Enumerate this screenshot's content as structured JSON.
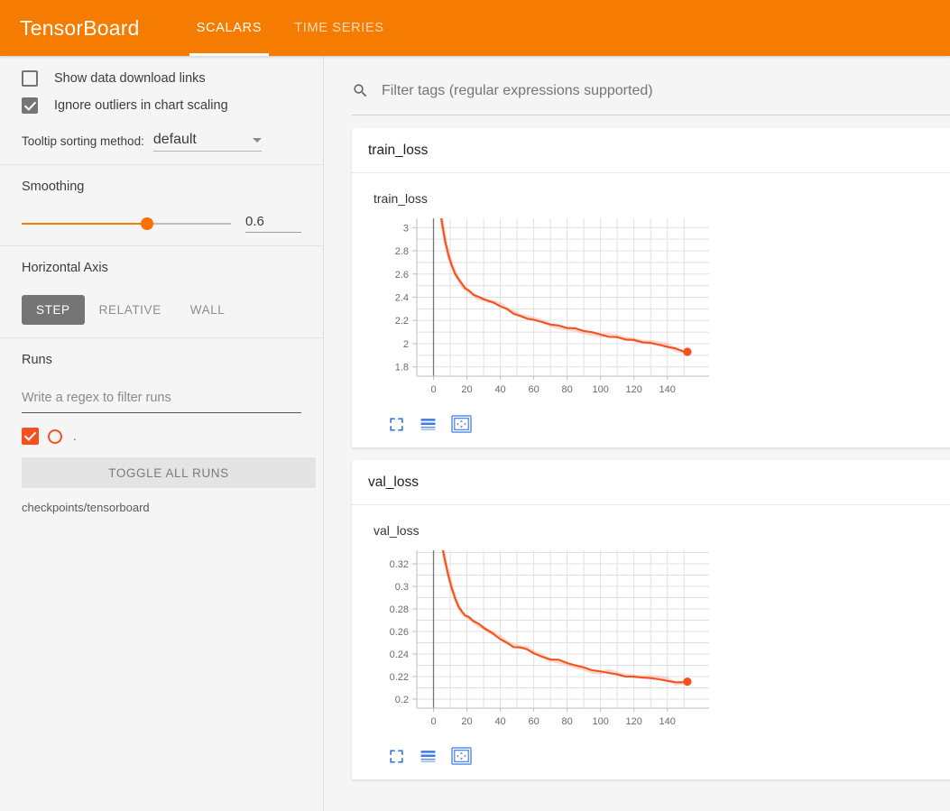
{
  "header": {
    "brand": "TensorBoard",
    "tabs": [
      {
        "label": "SCALARS",
        "active": true
      },
      {
        "label": "TIME SERIES",
        "active": false
      }
    ]
  },
  "sidebar": {
    "checkboxes": [
      {
        "label": "Show data download links",
        "checked": false
      },
      {
        "label": "Ignore outliers in chart scaling",
        "checked": true
      }
    ],
    "tooltip": {
      "label": "Tooltip sorting method:",
      "value": "default"
    },
    "smoothing": {
      "title": "Smoothing",
      "value": "0.6",
      "fraction": 0.6
    },
    "horizontal_axis": {
      "title": "Horizontal Axis",
      "buttons": [
        {
          "label": "STEP",
          "active": true
        },
        {
          "label": "RELATIVE",
          "active": false
        },
        {
          "label": "WALL",
          "active": false
        }
      ]
    },
    "runs": {
      "title": "Runs",
      "filter_placeholder": "Write a regex to filter runs",
      "filter_value": "",
      "run_name": ".",
      "run_color": "#f4511e",
      "toggle_all_label": "TOGGLE ALL RUNS",
      "logdir": "checkpoints/tensorboard"
    }
  },
  "main": {
    "filter_placeholder": "Filter tags (regular expressions supported)",
    "filter_value": "",
    "cards": [
      {
        "header": "train_loss",
        "chart_title": "train_loss"
      },
      {
        "header": "val_loss",
        "chart_title": "val_loss"
      }
    ],
    "toolbar_icons": [
      "expand-icon",
      "data-series-icon",
      "fit-domain-icon"
    ]
  },
  "colors": {
    "brand_orange": "#f57c00",
    "accent_orange": "#ff7003",
    "series_orange": "#f4511e",
    "icon_blue": "#3b78e7"
  },
  "chart_data": [
    {
      "type": "line",
      "title": "train_loss",
      "xlabel": "",
      "ylabel": "",
      "xlim": [
        -10,
        165
      ],
      "ylim": [
        1.72,
        3.08
      ],
      "xticks": [
        0,
        20,
        40,
        60,
        80,
        100,
        120,
        140
      ],
      "yticks": [
        1.8,
        2.0,
        2.2,
        2.4,
        2.6,
        2.8,
        3.0
      ],
      "ytick_labels": [
        "1.8",
        "2",
        "2.2",
        "2.4",
        "2.6",
        "2.8",
        "3"
      ],
      "grid": true,
      "legend": "none",
      "series": [
        {
          "name": "checkpoints/tensorboard",
          "color": "#f4511e",
          "end_marker": true,
          "x": [
            1,
            3,
            5,
            7,
            9,
            11,
            13,
            15,
            17,
            19,
            21,
            24,
            27,
            30,
            33,
            36,
            40,
            44,
            48,
            52,
            56,
            60,
            65,
            70,
            75,
            80,
            85,
            90,
            95,
            100,
            105,
            110,
            115,
            120,
            125,
            130,
            135,
            140,
            145,
            150,
            152
          ],
          "y": [
            3.55,
            3.28,
            3.05,
            2.88,
            2.76,
            2.67,
            2.6,
            2.555,
            2.515,
            2.48,
            2.455,
            2.425,
            2.4,
            2.385,
            2.368,
            2.352,
            2.325,
            2.295,
            2.262,
            2.235,
            2.218,
            2.205,
            2.185,
            2.168,
            2.152,
            2.14,
            2.128,
            2.112,
            2.098,
            2.078,
            2.062,
            2.052,
            2.04,
            2.028,
            2.015,
            2.005,
            1.99,
            1.975,
            1.955,
            1.935,
            1.93
          ]
        }
      ]
    },
    {
      "type": "line",
      "title": "val_loss",
      "xlabel": "",
      "ylabel": "",
      "xlim": [
        -10,
        165
      ],
      "ylim": [
        0.192,
        0.332
      ],
      "xticks": [
        0,
        20,
        40,
        60,
        80,
        100,
        120,
        140
      ],
      "yticks": [
        0.2,
        0.22,
        0.24,
        0.26,
        0.28,
        0.3,
        0.32
      ],
      "ytick_labels": [
        "0.2",
        "0.22",
        "0.24",
        "0.26",
        "0.28",
        "0.3",
        "0.32"
      ],
      "grid": true,
      "legend": "none",
      "series": [
        {
          "name": "checkpoints/tensorboard",
          "color": "#f4511e",
          "end_marker": true,
          "x": [
            1,
            3,
            5,
            7,
            9,
            11,
            13,
            15,
            17,
            19,
            21,
            24,
            27,
            30,
            33,
            36,
            40,
            44,
            48,
            52,
            56,
            60,
            65,
            70,
            75,
            80,
            85,
            90,
            95,
            100,
            105,
            110,
            115,
            120,
            125,
            130,
            135,
            140,
            145,
            150,
            152
          ],
          "y": [
            0.375,
            0.352,
            0.337,
            0.322,
            0.309,
            0.298,
            0.289,
            0.282,
            0.2775,
            0.2745,
            0.2725,
            0.2695,
            0.2665,
            0.2635,
            0.2605,
            0.2575,
            0.2535,
            0.2495,
            0.2465,
            0.2455,
            0.2445,
            0.2405,
            0.2375,
            0.2355,
            0.2345,
            0.2325,
            0.2295,
            0.2285,
            0.2255,
            0.2245,
            0.2235,
            0.2215,
            0.2205,
            0.2195,
            0.2195,
            0.2185,
            0.2175,
            0.2165,
            0.2145,
            0.2155,
            0.2155
          ]
        }
      ]
    }
  ]
}
